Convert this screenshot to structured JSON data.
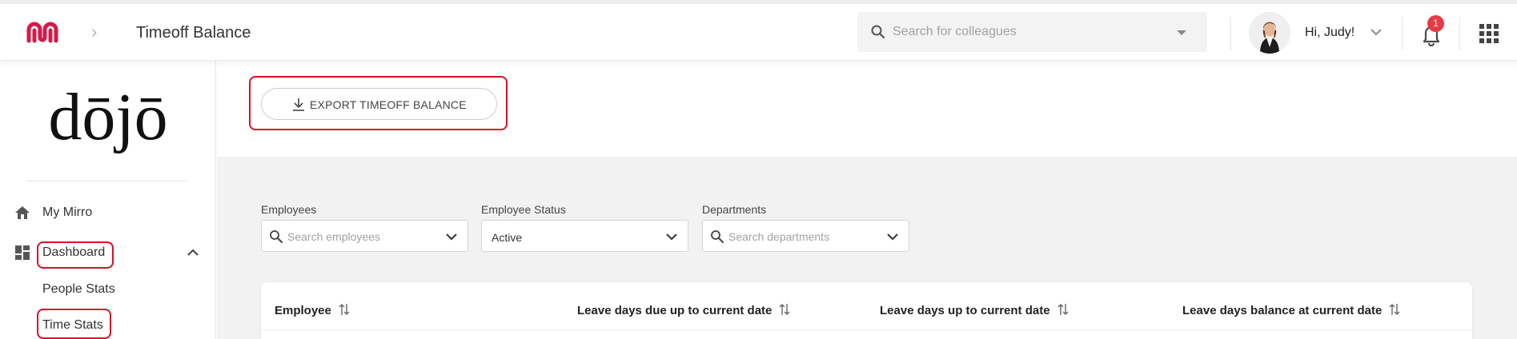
{
  "header": {
    "page_title": "Timeoff Balance",
    "search_placeholder": "Search for colleagues",
    "greeting": "Hi, Judy!",
    "notification_count": "1"
  },
  "sidebar": {
    "brand": "dōjō",
    "items": [
      {
        "label": "My Mirro",
        "icon": "home-icon"
      },
      {
        "label": "Dashboard",
        "icon": "dashboard-icon",
        "expanded": true
      },
      {
        "label": "People Stats"
      },
      {
        "label": "Time Stats"
      }
    ]
  },
  "main": {
    "export_label": "EXPORT TIMEOFF BALANCE",
    "filters": {
      "employees": {
        "label": "Employees",
        "placeholder": "Search employees"
      },
      "status": {
        "label": "Employee Status",
        "value": "Active"
      },
      "departments": {
        "label": "Departments",
        "placeholder": "Search departments"
      }
    },
    "table": {
      "columns": [
        "Employee",
        "Leave days due up to current date",
        "Leave days up to current date",
        "Leave days balance at current date"
      ]
    }
  },
  "colors": {
    "brand": "#d61a4a",
    "highlight": "#d90f2a",
    "badge": "#e53b45"
  }
}
